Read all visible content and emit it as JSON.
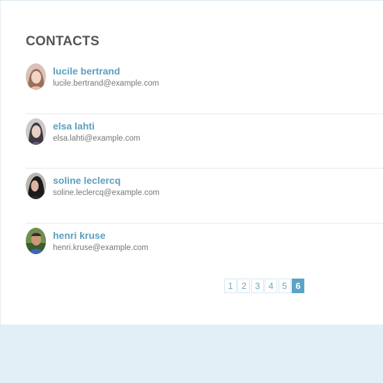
{
  "header": {
    "title": "CONTACTS"
  },
  "contacts": [
    {
      "name": "lucile bertrand",
      "email": "lucile.bertrand@example.com",
      "avatar_icon": "female-portrait"
    },
    {
      "name": "elsa lahti",
      "email": "elsa.lahti@example.com",
      "avatar_icon": "female-portrait"
    },
    {
      "name": "soline leclercq",
      "email": "soline.leclercq@example.com",
      "avatar_icon": "female-portrait"
    },
    {
      "name": "henri kruse",
      "email": "henri.kruse@example.com",
      "avatar_icon": "male-portrait"
    }
  ],
  "pagination": {
    "pages": [
      "1",
      "2",
      "3",
      "4",
      "5",
      "6"
    ],
    "current": "6"
  },
  "colors": {
    "accent": "#5ba3c7",
    "name_link": "#5a9fc0",
    "background": "#e3eff6"
  }
}
